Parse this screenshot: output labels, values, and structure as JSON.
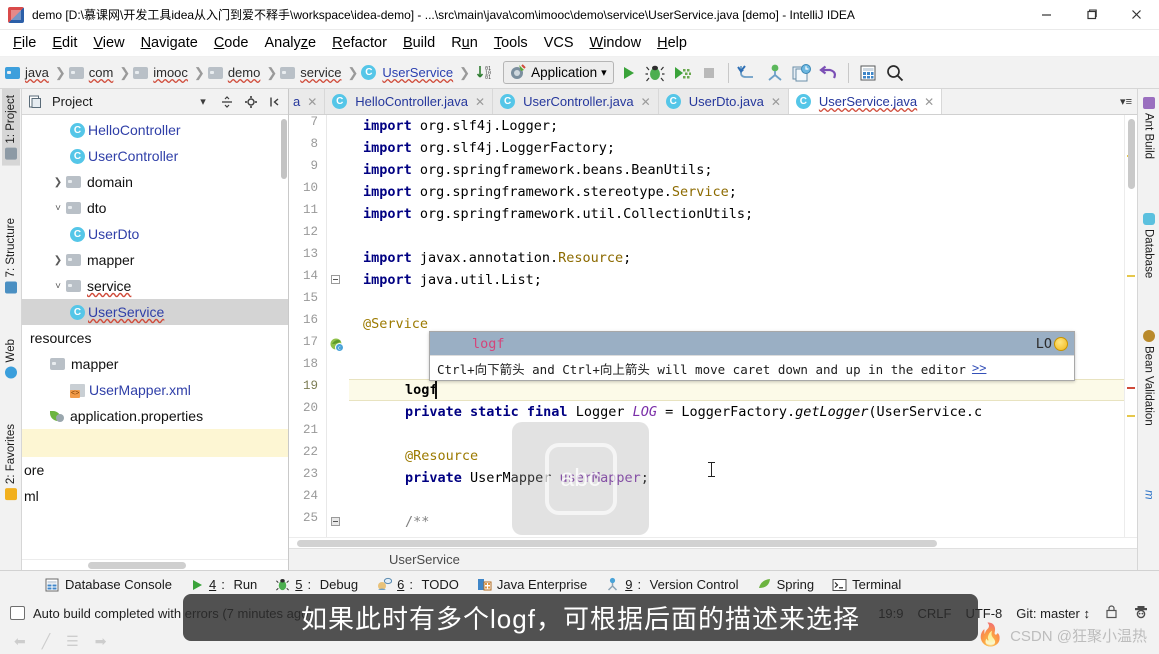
{
  "window": {
    "title": "demo [D:\\慕课网\\开发工具idea从入门到爱不释手\\workspace\\idea-demo] - ...\\src\\main\\java\\com\\imooc\\demo\\service\\UserService.java [demo] - IntelliJ IDEA",
    "minimize": "─",
    "maximize": "❐",
    "close": "✕"
  },
  "menu": [
    {
      "label": "File"
    },
    {
      "label": "Edit"
    },
    {
      "label": "View"
    },
    {
      "label": "Navigate"
    },
    {
      "label": "Code"
    },
    {
      "label": "Analyze"
    },
    {
      "label": "Refactor"
    },
    {
      "label": "Build"
    },
    {
      "label": "Run"
    },
    {
      "label": "Tools"
    },
    {
      "label": "VCS"
    },
    {
      "label": "Window"
    },
    {
      "label": "Help"
    }
  ],
  "breadcrumbs": [
    {
      "label": "java",
      "kind": "folder-blue"
    },
    {
      "label": "com",
      "kind": "folder"
    },
    {
      "label": "imooc",
      "kind": "folder"
    },
    {
      "label": "demo",
      "kind": "folder"
    },
    {
      "label": "service",
      "kind": "folder"
    },
    {
      "label": "UserService",
      "kind": "class"
    }
  ],
  "run_config": {
    "label": "Application",
    "chevron": "⌄"
  },
  "toolbar_icons": [
    {
      "name": "run-icon"
    },
    {
      "name": "debug-icon"
    },
    {
      "name": "run-coverage-icon"
    },
    {
      "name": "stop-icon"
    },
    {
      "name": "update-project-icon"
    },
    {
      "name": "commit-icon"
    },
    {
      "name": "vcs-history-icon"
    },
    {
      "name": "rollback-icon"
    },
    {
      "name": "database-icon"
    },
    {
      "name": "search-everywhere-icon"
    }
  ],
  "left_strip": [
    {
      "label": "1: Project",
      "active": true
    },
    {
      "label": "7: Structure",
      "active": false
    },
    {
      "label": "Web",
      "active": false
    },
    {
      "label": "2: Favorites",
      "active": false
    }
  ],
  "right_strip": [
    {
      "label": "Ant Build"
    },
    {
      "label": "Database"
    },
    {
      "label": "Bean Validation"
    },
    {
      "label": "m"
    }
  ],
  "project_panel": {
    "title": "Project",
    "tree": [
      {
        "label": "HelloController",
        "indent": 3,
        "kind": "class",
        "arrow": "",
        "selected": false
      },
      {
        "label": "UserController",
        "indent": 3,
        "kind": "class-run",
        "arrow": "",
        "selected": false
      },
      {
        "label": "domain",
        "indent": 2,
        "kind": "folder",
        "arrow": "›",
        "selected": false
      },
      {
        "label": "dto",
        "indent": 2,
        "kind": "folder",
        "arrow": "⌄",
        "selected": false
      },
      {
        "label": "UserDto",
        "indent": 3,
        "kind": "class",
        "arrow": "",
        "selected": false
      },
      {
        "label": "mapper",
        "indent": 2,
        "kind": "folder",
        "arrow": "›",
        "selected": false
      },
      {
        "label": "service",
        "indent": 2,
        "kind": "folder",
        "arrow": "⌄",
        "selected": false,
        "wavy": true
      },
      {
        "label": "UserService",
        "indent": 3,
        "kind": "class",
        "arrow": "",
        "selected": true,
        "wavy": true
      },
      {
        "label": "resources",
        "indent": 1,
        "kind": "plain",
        "arrow": "",
        "selected": false
      },
      {
        "label": "mapper",
        "indent": 2,
        "kind": "folder",
        "arrow": "",
        "selected": false
      },
      {
        "label": "UserMapper.xml",
        "indent": 3,
        "kind": "xml",
        "arrow": "",
        "selected": false
      },
      {
        "label": "application.properties",
        "indent": 2,
        "kind": "properties",
        "arrow": "",
        "selected": false
      },
      {
        "label": "",
        "indent": 1,
        "kind": "plain",
        "arrow": "",
        "selected": false,
        "highlight": true
      },
      {
        "label": "ore",
        "indent": 0,
        "kind": "plain",
        "arrow": "",
        "selected": false
      },
      {
        "label": "ml",
        "indent": 0,
        "kind": "plain",
        "arrow": "",
        "selected": false
      }
    ]
  },
  "editor_tabs": [
    {
      "label": "a",
      "truncated": true,
      "active": false
    },
    {
      "label": "HelloController.java",
      "active": false
    },
    {
      "label": "UserController.java",
      "active": false,
      "run_marker": true
    },
    {
      "label": "UserDto.java",
      "active": false
    },
    {
      "label": "UserService.java",
      "active": true,
      "wavy": true
    }
  ],
  "editor": {
    "lines": [
      {
        "num": "7",
        "text": "import org.slf4j.Logger;"
      },
      {
        "num": "8",
        "text": "import org.slf4j.LoggerFactory;"
      },
      {
        "num": "9",
        "text": "import org.springframework.beans.BeanUtils;"
      },
      {
        "num": "10",
        "text": "import org.springframework.stereotype.Service;"
      },
      {
        "num": "11",
        "text": "import org.springframework.util.CollectionUtils;"
      },
      {
        "num": "12",
        "text": ""
      },
      {
        "num": "13",
        "text": "import javax.annotation.Resource;"
      },
      {
        "num": "14",
        "text": "import java.util.List;"
      },
      {
        "num": "15",
        "text": ""
      },
      {
        "num": "16",
        "text": "@Service"
      },
      {
        "num": "17",
        "text": ""
      },
      {
        "num": "18",
        "text": ""
      },
      {
        "num": "19",
        "text": "logf"
      },
      {
        "num": "20",
        "text": "private static final Logger LOG = LoggerFactory.getLogger(UserService.c"
      },
      {
        "num": "21",
        "text": ""
      },
      {
        "num": "22",
        "text": "@Resource"
      },
      {
        "num": "23",
        "text": "private UserMapper userMapper;"
      },
      {
        "num": "24",
        "text": ""
      },
      {
        "num": "25",
        "text": "/**"
      }
    ],
    "typed_text": "logf",
    "bottom_breadcrumb": "UserService"
  },
  "completion_popup": {
    "item_text": "logf",
    "item_right": "LO",
    "hint_text": "Ctrl+向下箭头 and Ctrl+向上箭头 will move caret down and up in the editor",
    "hint_more": ">>"
  },
  "tool_windows": [
    {
      "label": "Database Console",
      "icon": "database-console-icon",
      "prefix": ""
    },
    {
      "label": "Run",
      "icon": "run-icon",
      "prefix": "4"
    },
    {
      "label": "Debug",
      "icon": "debug-icon",
      "prefix": "5"
    },
    {
      "label": "TODO",
      "icon": "todo-icon",
      "prefix": "6"
    },
    {
      "label": "Java Enterprise",
      "icon": "java-enterprise-icon",
      "prefix": ""
    },
    {
      "label": "Version Control",
      "icon": "version-control-icon",
      "prefix": "9"
    },
    {
      "label": "Spring",
      "icon": "spring-leaf-icon",
      "prefix": ""
    },
    {
      "label": "Terminal",
      "icon": "terminal-icon",
      "prefix": ""
    }
  ],
  "status_bar": {
    "message": "Auto build completed with errors (7 minutes ago)",
    "caret_position": "19:9",
    "line_separator": "CRLF",
    "encoding": "UTF-8",
    "git_branch": "Git: master",
    "git_chevron": "↕"
  },
  "overlays": {
    "subtitle": "如果此时有多个logf，可根据后面的描述来选择",
    "keyboard_key": "abc",
    "watermark_csdn": "CSDN @狂聚小温热"
  }
}
